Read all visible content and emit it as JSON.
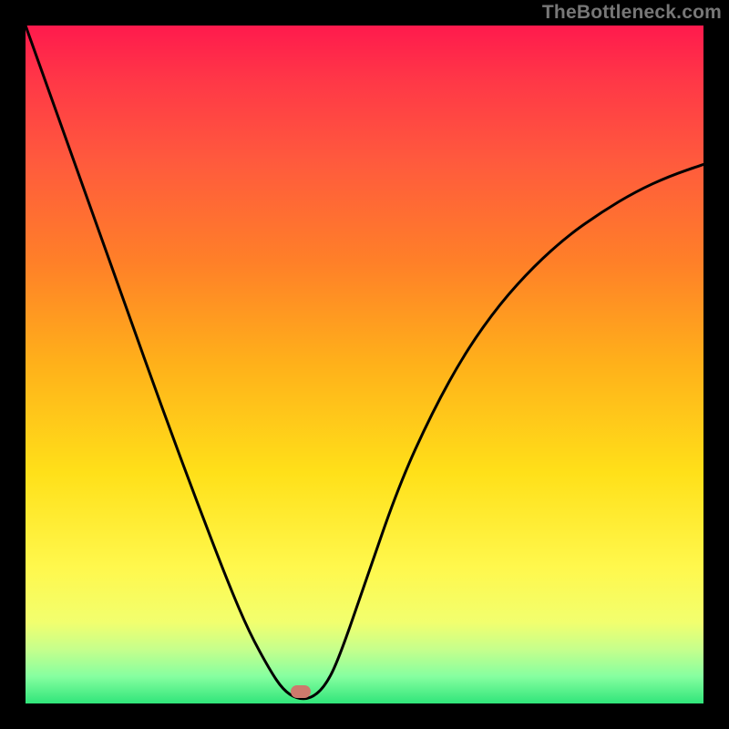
{
  "watermark": "TheBottleneck.com",
  "marker": {
    "x_frac": 0.406,
    "y_frac": 0.983
  },
  "chart_data": {
    "type": "line",
    "title": "",
    "xlabel": "",
    "ylabel": "",
    "xlim": [
      0,
      1
    ],
    "ylim": [
      0,
      1
    ],
    "note": "Axes unlabeled in source; values expressed as fractions of plot area (0 = left/bottom, 1 = right/top).",
    "series": [
      {
        "name": "curve",
        "x": [
          0.0,
          0.05,
          0.1,
          0.15,
          0.2,
          0.25,
          0.3,
          0.33,
          0.36,
          0.38,
          0.4,
          0.42,
          0.44,
          0.46,
          0.5,
          0.55,
          0.6,
          0.65,
          0.7,
          0.75,
          0.8,
          0.85,
          0.9,
          0.95,
          1.0
        ],
        "values": [
          1.0,
          0.86,
          0.72,
          0.58,
          0.44,
          0.305,
          0.175,
          0.105,
          0.05,
          0.02,
          0.007,
          0.007,
          0.023,
          0.06,
          0.175,
          0.32,
          0.43,
          0.52,
          0.59,
          0.645,
          0.69,
          0.725,
          0.755,
          0.778,
          0.795
        ]
      }
    ],
    "marker": {
      "x": 0.406,
      "y": 0.017
    },
    "background_gradient_top_to_bottom": [
      "#ff1a4d",
      "#ffe019",
      "#30e57a"
    ]
  }
}
